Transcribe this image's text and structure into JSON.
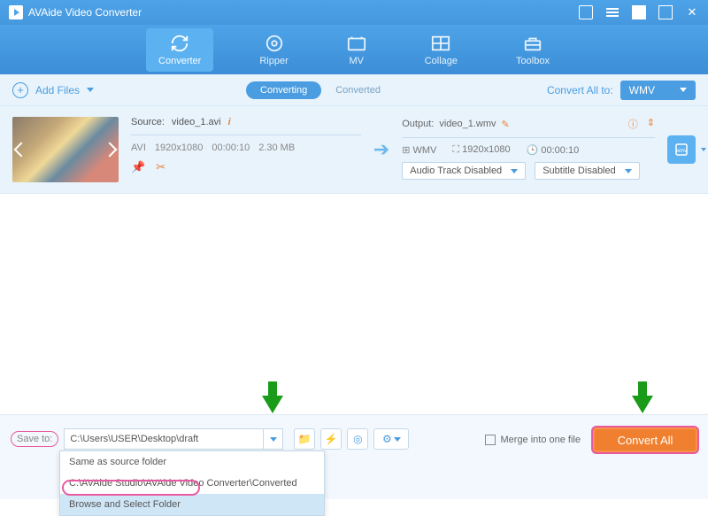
{
  "app": {
    "title": "AVAide Video Converter"
  },
  "tabs": {
    "converter": "Converter",
    "ripper": "Ripper",
    "mv": "MV",
    "collage": "Collage",
    "toolbox": "Toolbox"
  },
  "subbar": {
    "add_files": "Add Files",
    "converting": "Converting",
    "converted": "Converted",
    "convert_all_to": "Convert All to:",
    "format": "WMV"
  },
  "file": {
    "source_label": "Source:",
    "source_name": "video_1.avi",
    "codec": "AVI",
    "resolution": "1920x1080",
    "duration": "00:00:10",
    "size": "2.30 MB",
    "output_label": "Output:",
    "output_name": "video_1.wmv",
    "out_format": "WMV",
    "out_resolution": "1920x1080",
    "out_duration": "00:00:10",
    "audio_track": "Audio Track Disabled",
    "subtitle": "Subtitle Disabled"
  },
  "bottom": {
    "save_to": "Save to:",
    "path": "C:\\Users\\USER\\Desktop\\draft",
    "merge": "Merge into one file",
    "convert_all": "Convert All",
    "dd_same": "Same as source folder",
    "dd_recent": "C:\\AVAide Studio\\AVAide Video Converter\\Converted",
    "dd_browse": "Browse and Select Folder"
  }
}
